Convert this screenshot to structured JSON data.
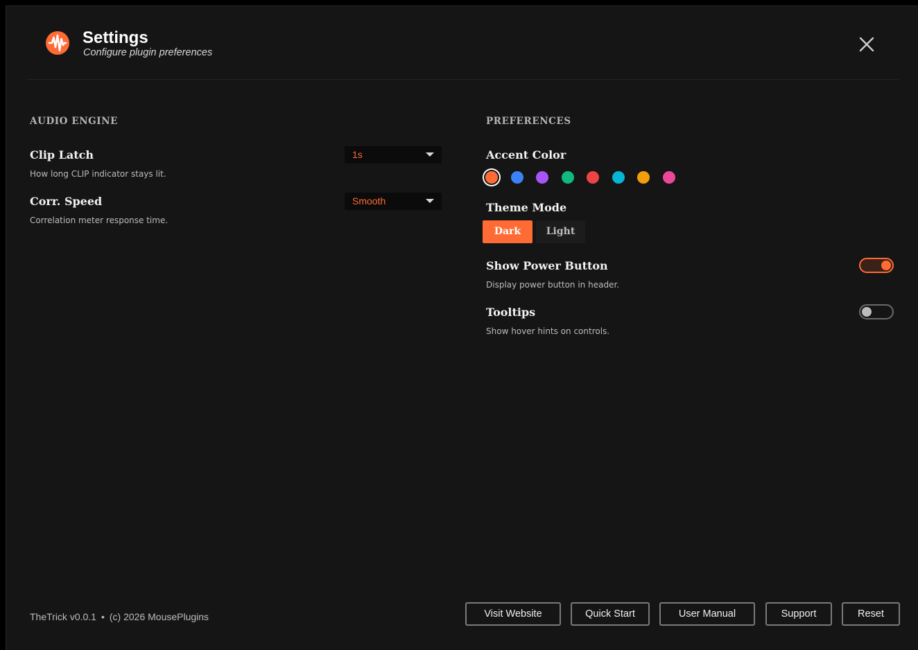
{
  "header": {
    "title": "Settings",
    "subtitle": "Configure plugin preferences",
    "logo_icon": "waveform-logo-icon",
    "close_icon": "close-icon"
  },
  "audio_engine": {
    "section_title": "AUDIO ENGINE",
    "clip_latch": {
      "title": "Clip Latch",
      "description": "How long CLIP indicator stays lit.",
      "value": "1s"
    },
    "corr_speed": {
      "title": "Corr. Speed",
      "description": "Correlation meter response time.",
      "value": "Smooth"
    }
  },
  "preferences": {
    "section_title": "PREFERENCES",
    "accent_color": {
      "title": "Accent Color",
      "swatches": [
        "#ff6b35",
        "#3b82f6",
        "#a855f7",
        "#10b981",
        "#ef4444",
        "#06b6d4",
        "#f59e0b",
        "#ec4899"
      ],
      "selected_index": 0
    },
    "theme_mode": {
      "title": "Theme Mode",
      "options": [
        "Dark",
        "Light"
      ],
      "selected": "Dark"
    },
    "show_power_button": {
      "title": "Show Power Button",
      "description": "Display power button in header.",
      "enabled": true
    },
    "tooltips": {
      "title": "Tooltips",
      "description": "Show hover hints on controls.",
      "enabled": false
    }
  },
  "footer": {
    "version": "TheTrick v0.0.1",
    "separator": "•",
    "copyright": "(c) 2026 MousePlugins",
    "buttons": {
      "visit_website": "Visit Website",
      "quick_start": "Quick Start",
      "user_manual": "User Manual",
      "support": "Support",
      "reset": "Reset"
    }
  },
  "colors": {
    "accent": "#ff6b35",
    "background": "#151515",
    "text": "#f2f2f2"
  }
}
